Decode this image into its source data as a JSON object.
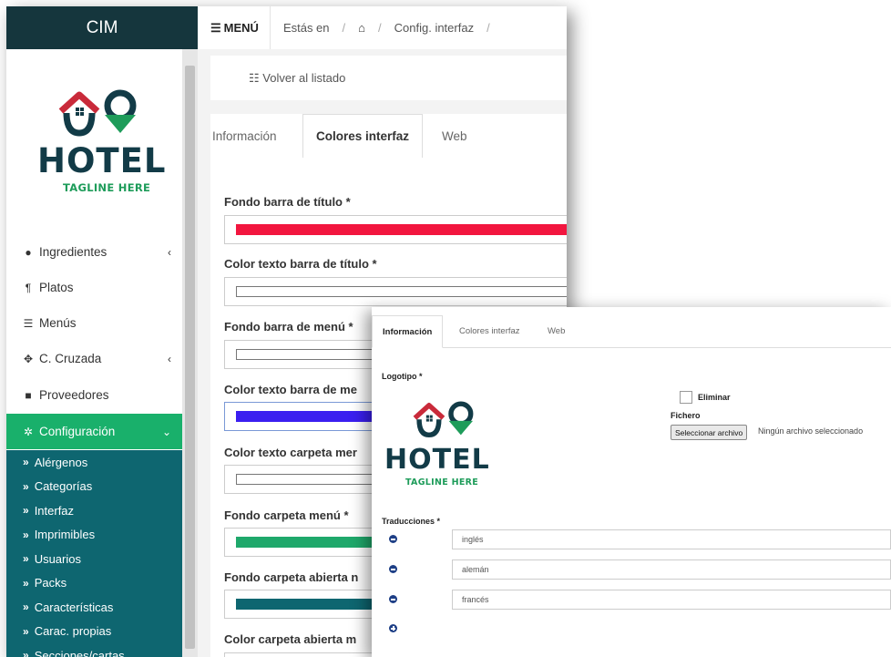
{
  "main_window": {
    "brand": "CIM",
    "topbar": {
      "menu_label": "MENÚ",
      "breadcrumb_prefix": "Estás en",
      "breadcrumb_current": "Config. interfaz"
    },
    "logo": {
      "name": "HOTEL",
      "tagline": "TAGLINE HERE"
    },
    "nav": [
      {
        "icon": "leaf-icon",
        "label": "Ingredientes",
        "has_children": true
      },
      {
        "icon": "cutlery-icon",
        "label": "Platos",
        "has_children": false
      },
      {
        "icon": "list-icon",
        "label": "Menús",
        "has_children": false
      },
      {
        "icon": "arrows-icon",
        "label": "C. Cruzada",
        "has_children": true
      },
      {
        "icon": "truck-icon",
        "label": "Proveedores",
        "has_children": false
      },
      {
        "icon": "gear-icon",
        "label": "Configuración",
        "has_children": true,
        "active": true
      }
    ],
    "subnav": [
      "Alérgenos",
      "Categorías",
      "Interfaz",
      "Imprimibles",
      "Usuarios",
      "Packs",
      "Características",
      "Carac. propias",
      "Secciones/cartas"
    ],
    "back_label": "Volver al listado",
    "tabs": [
      "Información",
      "Colores interfaz",
      "Web"
    ],
    "active_tab": "Colores interfaz",
    "fields": [
      {
        "label": "Fondo barra de título *",
        "color": "#f2163f"
      },
      {
        "label": "Color texto barra de título *",
        "color": "#ffffff"
      },
      {
        "label": "Fondo barra de menú *",
        "color": "#ffffff"
      },
      {
        "label": "Color texto barra de me",
        "color": "#3b1ff0"
      },
      {
        "label": "Color texto carpeta mer",
        "color": "#ffffff"
      },
      {
        "label": "Fondo carpeta menú *",
        "color": "#1fa86b"
      },
      {
        "label": "Fondo carpeta abierta n",
        "color": "#0e6670"
      },
      {
        "label": "Color carpeta abierta m",
        "color": "#ffffff"
      }
    ]
  },
  "overlay_window": {
    "tabs": [
      "Información",
      "Colores interfaz",
      "Web"
    ],
    "active_tab": "Información",
    "logo_label": "Logotipo *",
    "delete_label": "Eliminar",
    "file_label": "Fichero",
    "file_button": "Seleccionar archivo",
    "file_status": "Ningún archivo seleccionado",
    "translations_label": "Traducciones *",
    "translations": [
      "inglés",
      "alemán",
      "francés"
    ]
  },
  "colors": {
    "brand_bar": "#15363d",
    "accent_green": "#19b06b",
    "submenu_teal": "#0e6670"
  }
}
